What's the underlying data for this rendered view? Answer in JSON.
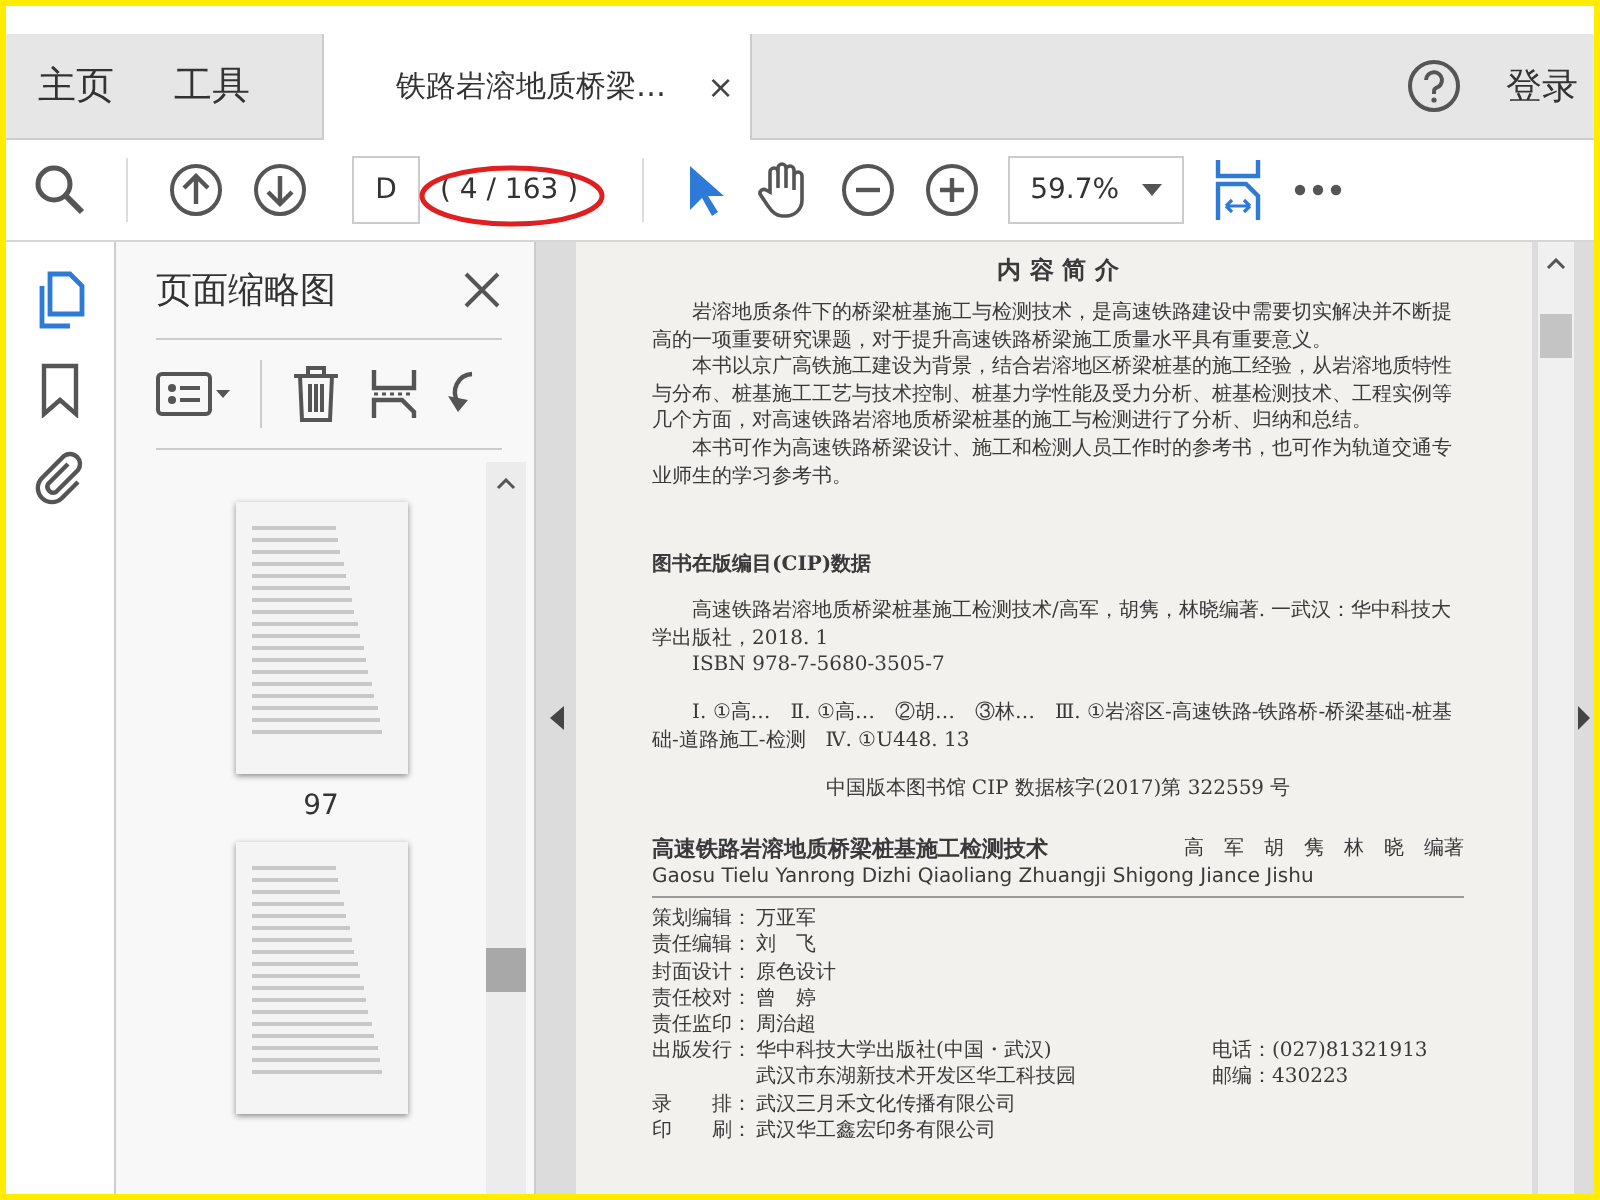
{
  "menu_tabs": [
    {
      "label": "主页"
    },
    {
      "label": "工具"
    }
  ],
  "document_tab": {
    "title": "铁路岩溶地质桥梁…",
    "close": "×"
  },
  "sign_in": "登录",
  "toolbar": {
    "page_input": "D",
    "page_count": "( 4 / 163 )",
    "zoom": "59.7%"
  },
  "side_panel": {
    "title": "页面缩略图",
    "thumbnails": [
      {
        "label": "97"
      }
    ],
    "next_thumbnail_partly_shown": true
  },
  "document": {
    "heading": "内 容 简 介",
    "paragraphs": [
      "岩溶地质条件下的桥梁桩基施工与检测技术，是高速铁路建设中需要切实解决并不断提高的一项重要研究课题，对于提升高速铁路桥梁施工质量水平具有重要意义。",
      "本书以京广高铁施工建设为背景，结合岩溶地区桥梁桩基的施工经验，从岩溶地质特性与分布、桩基施工工艺与技术控制、桩基力学性能及受力分析、桩基检测技术、工程实例等几个方面，对高速铁路岩溶地质桥梁桩基的施工与检测进行了分析、归纳和总结。",
      "本书可作为高速铁路桥梁设计、施工和检测人员工作时的参考书，也可作为轨道交通专业师生的学习参考书。"
    ],
    "cip_heading": "图书在版编目(CIP)数据",
    "cip_paragraphs": [
      "高速铁路岩溶地质桥梁桩基施工检测技术/高军，胡隽，林晓编著. 一武汉：华中科技大学出版社，2018. 1",
      "ISBN 978-7-5680-3505-7"
    ],
    "cip_classes": "Ⅰ. ①高…　Ⅱ. ①高…　②胡…　③林…　Ⅲ. ①岩溶区-高速铁路-铁路桥-桥梁基础-桩基础-道路施工-检测　Ⅳ. ①U448. 13",
    "cip_check": "中国版本图书馆 CIP 数据核字(2017)第 322559 号",
    "book_title": "高速铁路岩溶地质桥梁桩基施工检测技术",
    "authors": "高　军　胡　隽　林　晓　编著",
    "pinyin": "Gaosu Tielu Yanrong Dizhi Qiaoliang Zhuangji Shigong Jiance Jishu",
    "credits": [
      {
        "label": "策划编辑：",
        "value": "万亚军"
      },
      {
        "label": "责任编辑：",
        "value": "刘　飞"
      },
      {
        "label": "封面设计：",
        "value": "原色设计"
      },
      {
        "label": "责任校对：",
        "value": "曾　婷"
      },
      {
        "label": "责任监印：",
        "value": "周治超"
      },
      {
        "label": "出版发行：",
        "value": "华中科技大学出版社(中国・武汉)",
        "extra": "电话：(027)81321913"
      },
      {
        "value": "武汉市东湖新技术开发区华工科技园",
        "extra": "邮编：430223"
      },
      {
        "label": "录　　排：",
        "value": "武汉三月禾文化传播有限公司"
      },
      {
        "label": "印　　刷：",
        "value": "武汉华工鑫宏印务有限公司"
      }
    ]
  }
}
